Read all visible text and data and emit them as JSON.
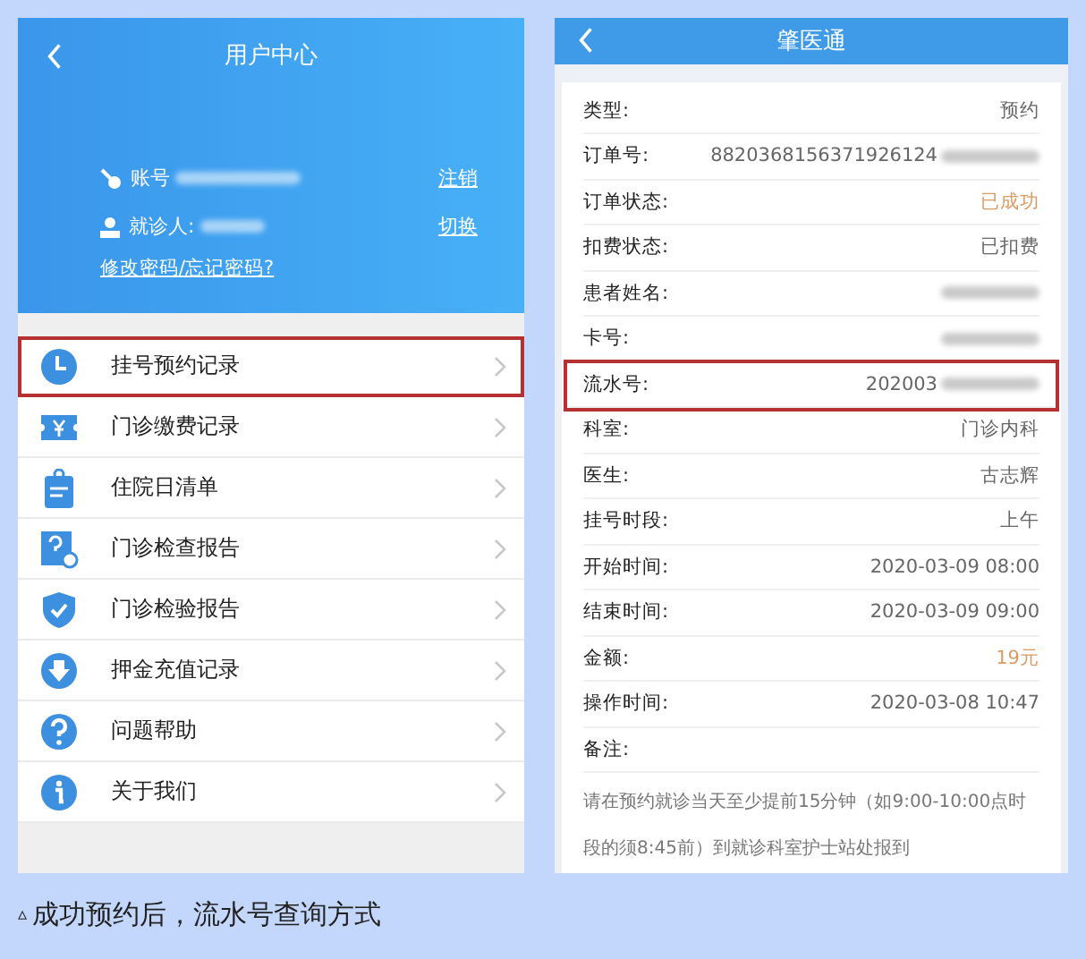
{
  "left_screen": {
    "title": "用户中心",
    "account": {
      "label": "账号",
      "value_blurred": true,
      "action": "注销"
    },
    "patient": {
      "label": "就诊人:",
      "value_blurred": true,
      "action": "切换"
    },
    "password_link": "修改密码/忘记密码?",
    "menu": [
      {
        "label": "挂号预约记录",
        "highlighted": true
      },
      {
        "label": "门诊缴费记录",
        "highlighted": false
      },
      {
        "label": "住院日清单",
        "highlighted": false
      },
      {
        "label": "门诊检查报告",
        "highlighted": false
      },
      {
        "label": "门诊检验报告",
        "highlighted": false
      },
      {
        "label": "押金充值记录",
        "highlighted": false
      },
      {
        "label": "问题帮助",
        "highlighted": false
      },
      {
        "label": "关于我们",
        "highlighted": false
      }
    ]
  },
  "right_screen": {
    "title": "肇医通",
    "rows": [
      {
        "kind": "field",
        "label": "类型:",
        "value": "预约",
        "accent": false,
        "blurred": false,
        "highlighted": false
      },
      {
        "kind": "field",
        "label": "订单号:",
        "value": "8820368156371926124",
        "accent": false,
        "blurred": true,
        "highlighted": false
      },
      {
        "kind": "field",
        "label": "订单状态:",
        "value": "已成功",
        "accent": true,
        "blurred": false,
        "highlighted": false
      },
      {
        "kind": "field",
        "label": "扣费状态:",
        "value": "已扣费",
        "accent": false,
        "blurred": false,
        "highlighted": false
      },
      {
        "kind": "field",
        "label": "患者姓名:",
        "blurred": true,
        "highlighted": false
      },
      {
        "kind": "field",
        "label": "卡号:",
        "blurred": true,
        "highlighted": false
      },
      {
        "kind": "field",
        "label": "流水号:",
        "value": "202003",
        "accent": false,
        "blurred": true,
        "highlighted": true
      },
      {
        "kind": "field",
        "label": "科室:",
        "value": "门诊内科",
        "accent": false,
        "blurred": false,
        "highlighted": false
      },
      {
        "kind": "field",
        "label": "医生:",
        "value": "古志辉",
        "accent": false,
        "blurred": false,
        "highlighted": false
      },
      {
        "kind": "field",
        "label": "挂号时段:",
        "value": "上午",
        "accent": false,
        "blurred": false,
        "highlighted": false
      },
      {
        "kind": "field",
        "label": "开始时间:",
        "value": "2020-03-09 08:00",
        "accent": false,
        "blurred": false,
        "highlighted": false
      },
      {
        "kind": "field",
        "label": "结束时间:",
        "value": "2020-03-09 09:00",
        "accent": false,
        "blurred": false,
        "highlighted": false
      },
      {
        "kind": "field",
        "label": "金额:",
        "value": "19元",
        "accent": true,
        "blurred": false,
        "highlighted": false
      },
      {
        "kind": "field",
        "label": "操作时间:",
        "value": "2020-03-08 10:47",
        "accent": false,
        "blurred": false,
        "highlighted": false
      },
      {
        "kind": "field",
        "label": "备注:",
        "blurred": false,
        "highlighted": false
      },
      {
        "kind": "note",
        "text": "请在预约就诊当天至少提前15分钟（如9:00-10:00点时段的须8:45前）到就诊科室护士站处报到"
      }
    ]
  },
  "caption": {
    "mark": "▵",
    "text": "成功预约后，流水号查询方式"
  }
}
